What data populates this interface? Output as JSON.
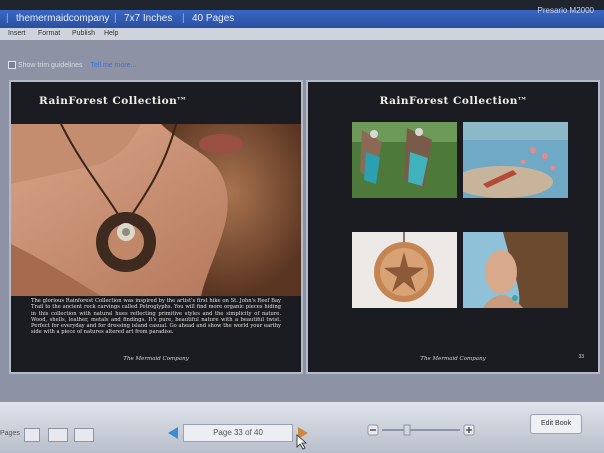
{
  "titlebar": {
    "segments": [
      "themermaidcompany",
      "7x7 Inches",
      "40 Pages"
    ],
    "brand": "Presario M2000"
  },
  "menubar": {
    "items": [
      "Insert",
      "Format",
      "Publish",
      "Help"
    ]
  },
  "guides": {
    "label": "Show trim guidelines",
    "link": "Tell me more..."
  },
  "spread": {
    "left": {
      "title": "RainForest Collection",
      "title_suffix": "TM",
      "description": "The glorious Rainforest Collection was inspired by the artist's first hike on St. John's Reef Bay Trail to the ancient rock carvings called Petroglyphs. You will find more organic pieces hiding in this collection with natural hues reflecting primitive styles and the simplicity of nature. Wood, shells, leather, metals and findings. It's pure, beautiful nature with a beautiful twist. Perfect for everyday and for dressing island casual. Go ahead and show the world your earthy side with a piece of natures altered art from paradise.",
      "company": "The Mermaid Company"
    },
    "right": {
      "title": "RainForest Collection",
      "title_suffix": "TM",
      "company": "The Mermaid Company",
      "page_number": "33"
    }
  },
  "bottombar": {
    "left_label": "Pages",
    "page_indicator": "Page 33 of 40",
    "edit_button": "Edit Book"
  },
  "colors": {
    "accent": "#3b6fe0",
    "page_bg": "#1b1b22",
    "workspace": "#8d93a4"
  }
}
